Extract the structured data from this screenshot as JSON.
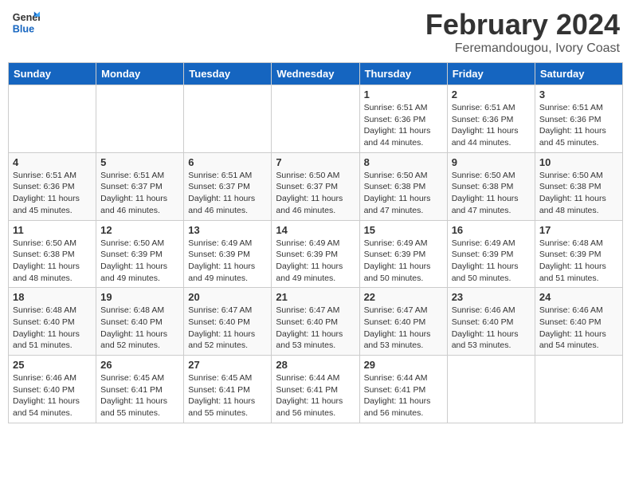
{
  "logo": {
    "line1": "General",
    "line2": "Blue"
  },
  "header": {
    "month": "February 2024",
    "location": "Feremandougou, Ivory Coast"
  },
  "weekdays": [
    "Sunday",
    "Monday",
    "Tuesday",
    "Wednesday",
    "Thursday",
    "Friday",
    "Saturday"
  ],
  "weeks": [
    [
      {
        "day": "",
        "info": ""
      },
      {
        "day": "",
        "info": ""
      },
      {
        "day": "",
        "info": ""
      },
      {
        "day": "",
        "info": ""
      },
      {
        "day": "1",
        "info": "Sunrise: 6:51 AM\nSunset: 6:36 PM\nDaylight: 11 hours\nand 44 minutes."
      },
      {
        "day": "2",
        "info": "Sunrise: 6:51 AM\nSunset: 6:36 PM\nDaylight: 11 hours\nand 44 minutes."
      },
      {
        "day": "3",
        "info": "Sunrise: 6:51 AM\nSunset: 6:36 PM\nDaylight: 11 hours\nand 45 minutes."
      }
    ],
    [
      {
        "day": "4",
        "info": "Sunrise: 6:51 AM\nSunset: 6:36 PM\nDaylight: 11 hours\nand 45 minutes."
      },
      {
        "day": "5",
        "info": "Sunrise: 6:51 AM\nSunset: 6:37 PM\nDaylight: 11 hours\nand 46 minutes."
      },
      {
        "day": "6",
        "info": "Sunrise: 6:51 AM\nSunset: 6:37 PM\nDaylight: 11 hours\nand 46 minutes."
      },
      {
        "day": "7",
        "info": "Sunrise: 6:50 AM\nSunset: 6:37 PM\nDaylight: 11 hours\nand 46 minutes."
      },
      {
        "day": "8",
        "info": "Sunrise: 6:50 AM\nSunset: 6:38 PM\nDaylight: 11 hours\nand 47 minutes."
      },
      {
        "day": "9",
        "info": "Sunrise: 6:50 AM\nSunset: 6:38 PM\nDaylight: 11 hours\nand 47 minutes."
      },
      {
        "day": "10",
        "info": "Sunrise: 6:50 AM\nSunset: 6:38 PM\nDaylight: 11 hours\nand 48 minutes."
      }
    ],
    [
      {
        "day": "11",
        "info": "Sunrise: 6:50 AM\nSunset: 6:38 PM\nDaylight: 11 hours\nand 48 minutes."
      },
      {
        "day": "12",
        "info": "Sunrise: 6:50 AM\nSunset: 6:39 PM\nDaylight: 11 hours\nand 49 minutes."
      },
      {
        "day": "13",
        "info": "Sunrise: 6:49 AM\nSunset: 6:39 PM\nDaylight: 11 hours\nand 49 minutes."
      },
      {
        "day": "14",
        "info": "Sunrise: 6:49 AM\nSunset: 6:39 PM\nDaylight: 11 hours\nand 49 minutes."
      },
      {
        "day": "15",
        "info": "Sunrise: 6:49 AM\nSunset: 6:39 PM\nDaylight: 11 hours\nand 50 minutes."
      },
      {
        "day": "16",
        "info": "Sunrise: 6:49 AM\nSunset: 6:39 PM\nDaylight: 11 hours\nand 50 minutes."
      },
      {
        "day": "17",
        "info": "Sunrise: 6:48 AM\nSunset: 6:39 PM\nDaylight: 11 hours\nand 51 minutes."
      }
    ],
    [
      {
        "day": "18",
        "info": "Sunrise: 6:48 AM\nSunset: 6:40 PM\nDaylight: 11 hours\nand 51 minutes."
      },
      {
        "day": "19",
        "info": "Sunrise: 6:48 AM\nSunset: 6:40 PM\nDaylight: 11 hours\nand 52 minutes."
      },
      {
        "day": "20",
        "info": "Sunrise: 6:47 AM\nSunset: 6:40 PM\nDaylight: 11 hours\nand 52 minutes."
      },
      {
        "day": "21",
        "info": "Sunrise: 6:47 AM\nSunset: 6:40 PM\nDaylight: 11 hours\nand 53 minutes."
      },
      {
        "day": "22",
        "info": "Sunrise: 6:47 AM\nSunset: 6:40 PM\nDaylight: 11 hours\nand 53 minutes."
      },
      {
        "day": "23",
        "info": "Sunrise: 6:46 AM\nSunset: 6:40 PM\nDaylight: 11 hours\nand 53 minutes."
      },
      {
        "day": "24",
        "info": "Sunrise: 6:46 AM\nSunset: 6:40 PM\nDaylight: 11 hours\nand 54 minutes."
      }
    ],
    [
      {
        "day": "25",
        "info": "Sunrise: 6:46 AM\nSunset: 6:40 PM\nDaylight: 11 hours\nand 54 minutes."
      },
      {
        "day": "26",
        "info": "Sunrise: 6:45 AM\nSunset: 6:41 PM\nDaylight: 11 hours\nand 55 minutes."
      },
      {
        "day": "27",
        "info": "Sunrise: 6:45 AM\nSunset: 6:41 PM\nDaylight: 11 hours\nand 55 minutes."
      },
      {
        "day": "28",
        "info": "Sunrise: 6:44 AM\nSunset: 6:41 PM\nDaylight: 11 hours\nand 56 minutes."
      },
      {
        "day": "29",
        "info": "Sunrise: 6:44 AM\nSunset: 6:41 PM\nDaylight: 11 hours\nand 56 minutes."
      },
      {
        "day": "",
        "info": ""
      },
      {
        "day": "",
        "info": ""
      }
    ]
  ]
}
